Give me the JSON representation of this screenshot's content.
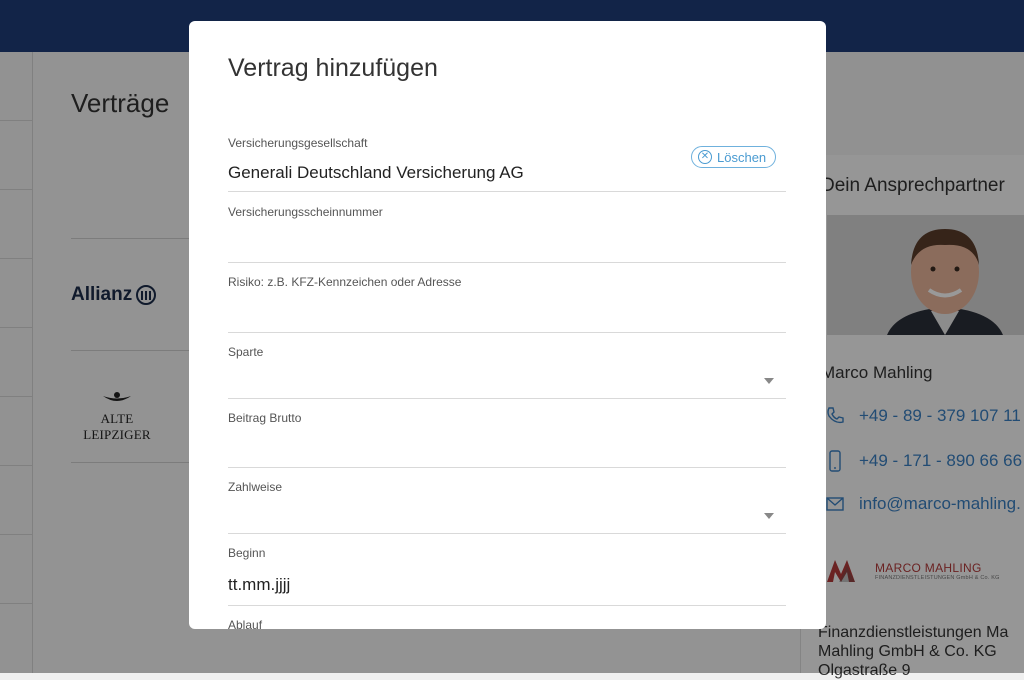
{
  "page": {
    "title": "Verträge"
  },
  "insurers": [
    {
      "name": "Allianz",
      "icon": "allianz-logo"
    },
    {
      "name": "ALTE LEIPZIGER",
      "icon": "alte-leipziger-logo"
    }
  ],
  "contact": {
    "title": "Dein Ansprechpartner",
    "name": "Marco Mahling",
    "phone": "+49 - 89 - 379 107 11",
    "mobile": "+49 - 171 - 890 66 66",
    "email": "info@marco-mahling.",
    "company_logo_title": "MARCO MAHLING",
    "company_logo_sub": "FINANZDIENSTLEISTUNGEN GmbH & Co. KG",
    "company_name_line1": "Finanzdienstleistungen Ma",
    "company_name_line2": "Mahling GmbH & Co. KG",
    "address_partial": "Olgastraße 9"
  },
  "modal": {
    "title": "Vertrag hinzufügen",
    "clear_label": "Löschen",
    "fields": {
      "company": {
        "label": "Versicherungsgesellschaft",
        "value": "Generali Deutschland Versicherung AG"
      },
      "policy_number": {
        "label": "Versicherungsscheinnummer",
        "value": ""
      },
      "risk": {
        "label": "Risiko: z.B. KFZ-Kennzeichen oder Adresse",
        "value": ""
      },
      "branch": {
        "label": "Sparte",
        "value": ""
      },
      "premium": {
        "label": "Beitrag Brutto",
        "value": ""
      },
      "payment": {
        "label": "Zahlweise",
        "value": ""
      },
      "start": {
        "label": "Beginn",
        "value": "tt.mm.jjjj"
      },
      "end": {
        "label": "Ablauf",
        "value": ""
      }
    }
  },
  "colors": {
    "topbar": "#1f3c78",
    "link": "#3a7fc1",
    "brand_red": "#b23a3a"
  }
}
